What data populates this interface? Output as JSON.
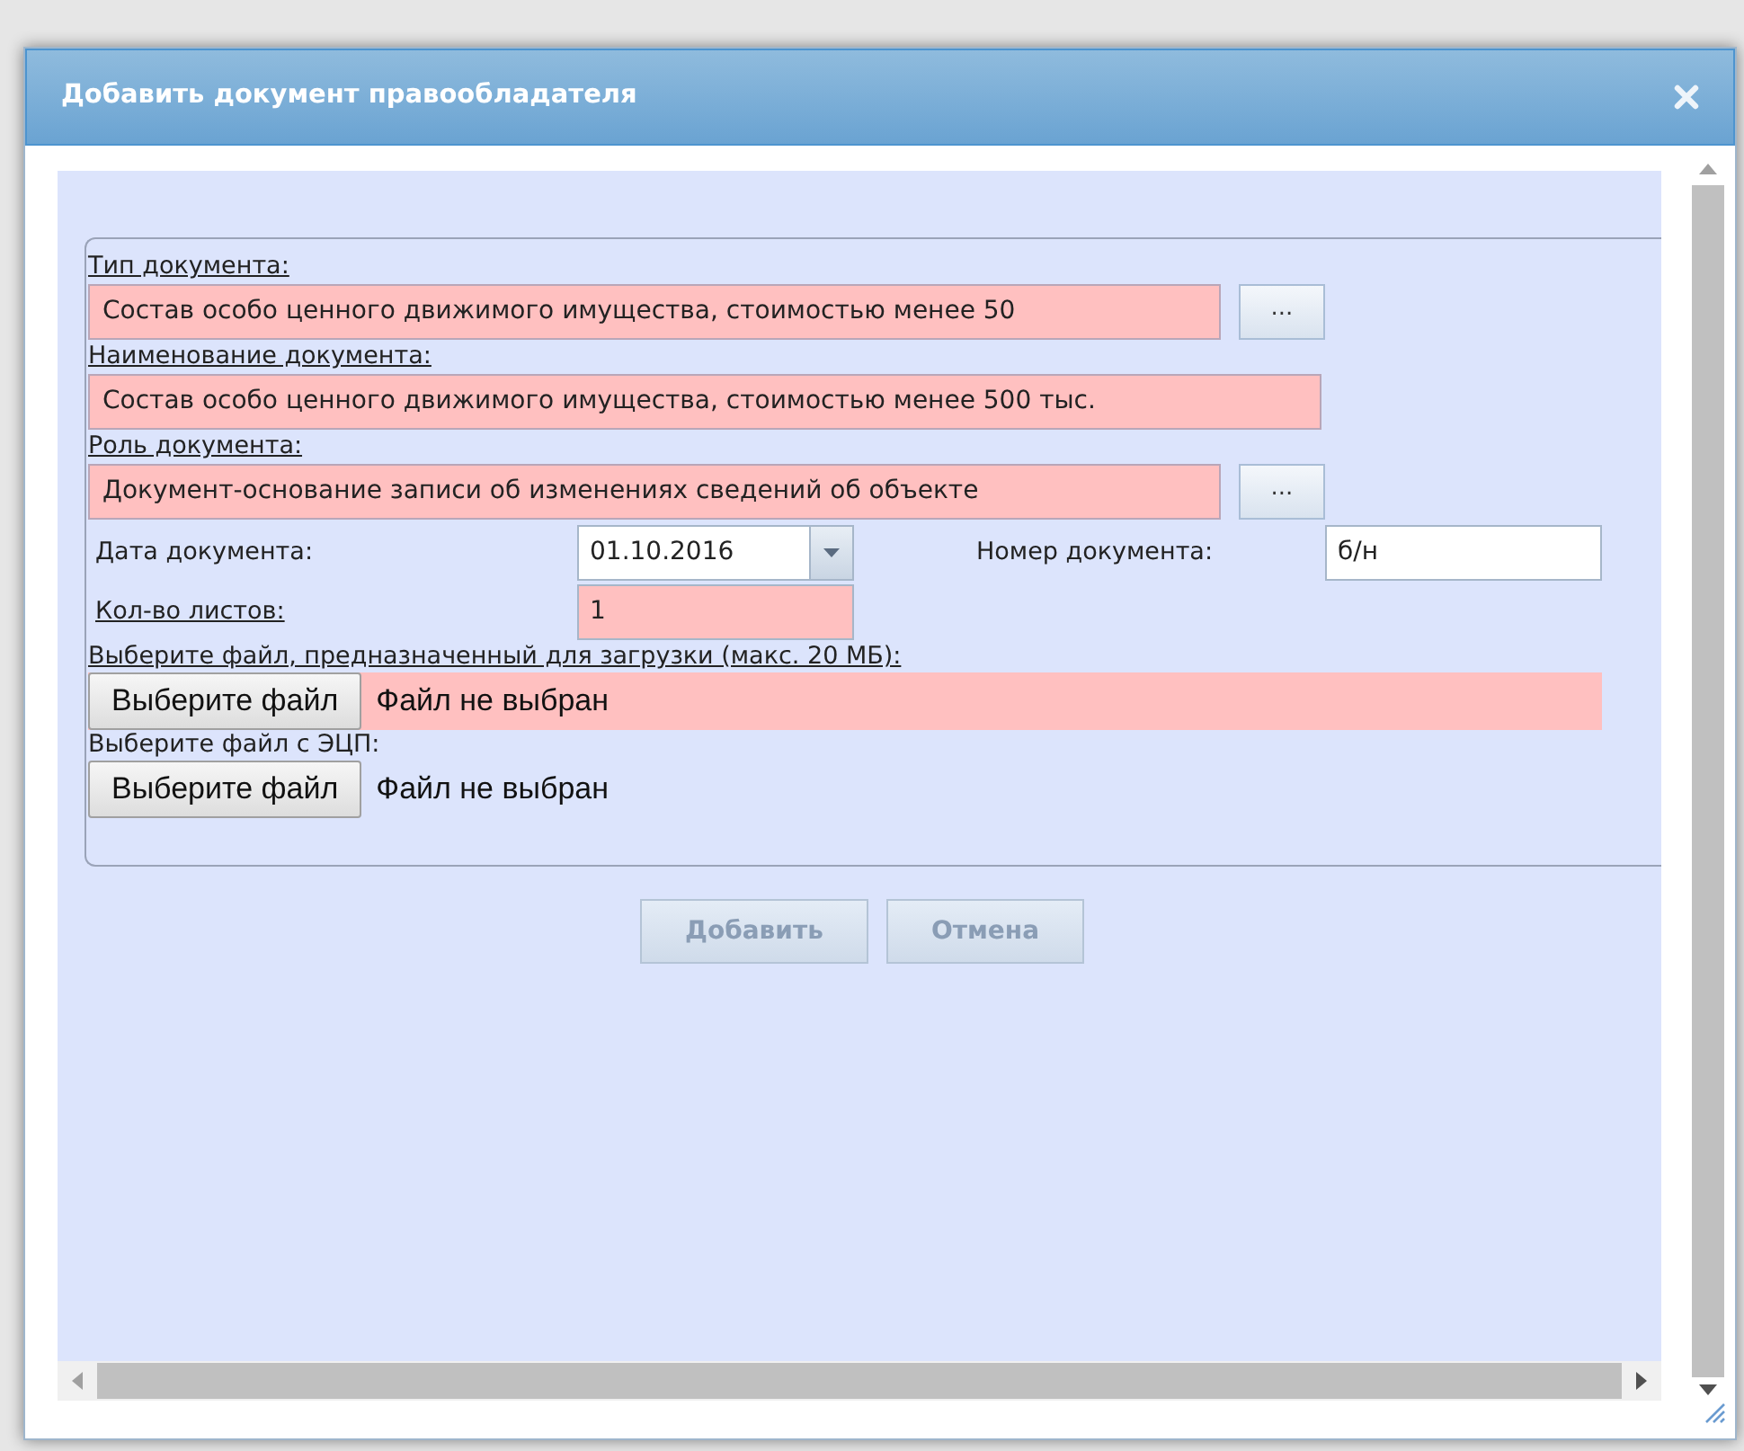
{
  "dialog": {
    "title": "Добавить документ правообладателя"
  },
  "fields": [
    {
      "kind": "picker",
      "label": "Тип документа:",
      "required": true,
      "value": "Состав особо ценного движимого имущества, стоимостью менее 50",
      "invalid": true,
      "button": "..."
    },
    {
      "kind": "text",
      "label": "Наименование документа:",
      "required": true,
      "value": "Состав особо ценного движимого имущества, стоимостью менее 500 тыс.",
      "invalid": true
    },
    {
      "kind": "picker",
      "label": "Роль документа:",
      "required": true,
      "value": "Документ-основание записи об изменениях сведений об объекте",
      "invalid": true,
      "button": "..."
    }
  ],
  "date": {
    "label": "Дата документа:",
    "required": false,
    "value": "01.10.2016"
  },
  "number": {
    "label": "Номер документа:",
    "required": false,
    "value": "б/н"
  },
  "sheets": {
    "label": "Кол-во листов:",
    "required": true,
    "value": "1",
    "invalid": true
  },
  "files": [
    {
      "label": "Выберите файл, предназначенный для загрузки (макс. 20 МБ):",
      "required": true,
      "button": "Выберите файл",
      "status": "Файл не выбран",
      "invalid": true
    },
    {
      "label": "Выберите файл с ЭЦП:",
      "required": false,
      "button": "Выберите файл",
      "status": "Файл не выбран",
      "invalid": false
    }
  ],
  "buttons": [
    {
      "label": "Добавить",
      "disabled": true
    },
    {
      "label": "Отмена",
      "disabled": true
    }
  ]
}
